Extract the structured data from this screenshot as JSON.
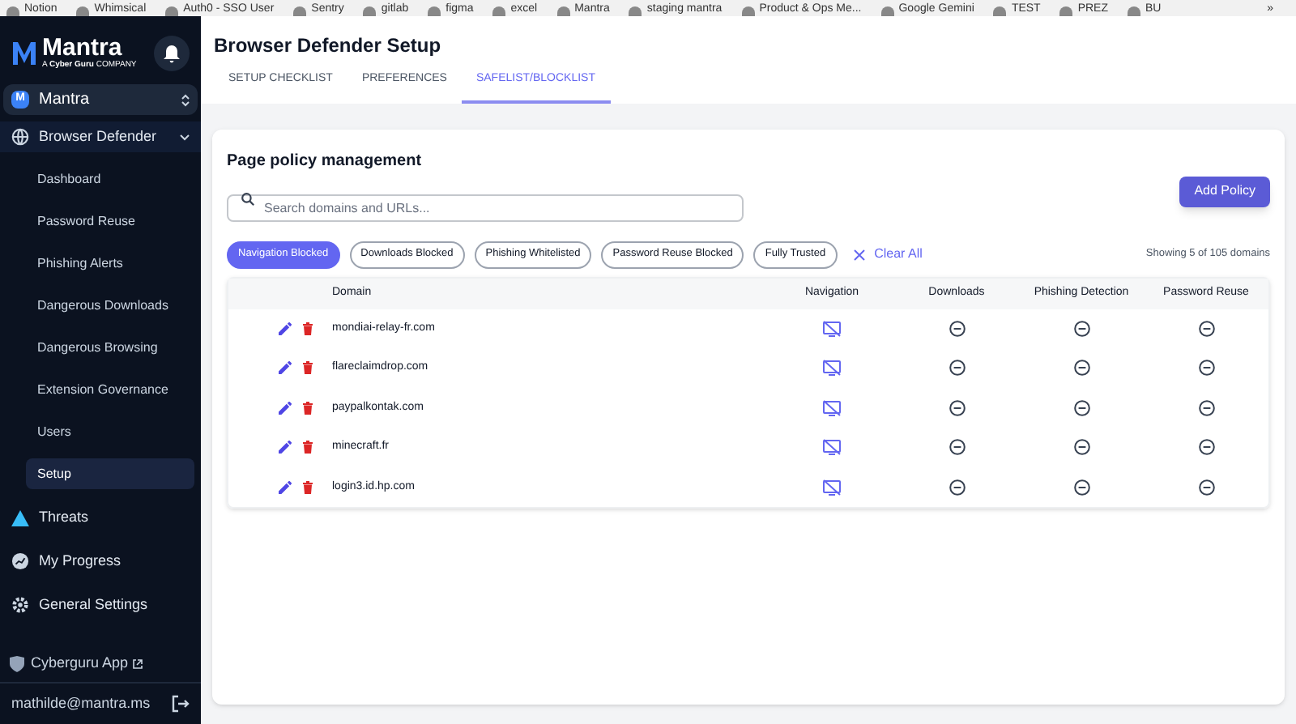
{
  "bookmarks": [
    "Notion",
    "Whimsical",
    "Auth0 - SSO User",
    "Sentry",
    "gitlab",
    "figma",
    "excel",
    "Mantra",
    "staging mantra",
    "Product & Ops Me...",
    "Google Gemini",
    "TEST",
    "PREZ",
    "BU"
  ],
  "bookmarks_more": "»",
  "sidebar": {
    "brand": "Mantra",
    "brand_sub": "A **Cyber Guru** COMPANY",
    "org": {
      "badge": "M",
      "name": "Mantra"
    },
    "items": [
      {
        "label": "Browser Defender",
        "kind": "globe",
        "expanded": true,
        "selected": false,
        "children": [
          {
            "label": "Dashboard",
            "selected": false
          },
          {
            "label": "Password Reuse",
            "selected": false
          },
          {
            "label": "Phishing Alerts",
            "selected": false
          },
          {
            "label": "Dangerous Downloads",
            "selected": false
          },
          {
            "label": "Dangerous Browsing",
            "selected": false
          },
          {
            "label": "Extension Governance",
            "selected": false
          },
          {
            "label": "Users",
            "selected": false
          },
          {
            "label": "Setup",
            "selected": true
          }
        ]
      },
      {
        "label": "Threats",
        "kind": "warning",
        "selected": false
      },
      {
        "label": "My Progress",
        "kind": "progress",
        "selected": false
      },
      {
        "label": "General Settings",
        "kind": "gear",
        "selected": false
      }
    ],
    "app_link": "Cyberguru App",
    "user_email": "mathilde@mantra.ms"
  },
  "header": {
    "title": "Browser Defender Setup",
    "tabs": [
      {
        "label": "SETUP CHECKLIST",
        "selected": false
      },
      {
        "label": "PREFERENCES",
        "selected": false
      },
      {
        "label": "SAFELIST/BLOCKLIST",
        "selected": true
      }
    ]
  },
  "card": {
    "title": "Page policy management",
    "search": {
      "placeholder": "Search domains and URLs..."
    },
    "add_button": "Add Policy",
    "filters": [
      {
        "label": "Navigation Blocked",
        "selected": true
      },
      {
        "label": "Downloads Blocked",
        "selected": false
      },
      {
        "label": "Phishing Whitelisted",
        "selected": false
      },
      {
        "label": "Password Reuse Blocked",
        "selected": false
      },
      {
        "label": "Fully Trusted",
        "selected": false
      }
    ],
    "clear_all": "Clear All",
    "count": "Showing 5 of 105 domains",
    "columns": [
      "Domain",
      "Navigation",
      "Downloads",
      "Phishing Detection",
      "Password Reuse"
    ],
    "rows": [
      {
        "domain": "mondiai-relay-fr.com",
        "navigation_blocked": true,
        "downloads_blocked": false,
        "phishing_blocked": false,
        "password_blocked": false
      },
      {
        "domain": "flareclaimdrop.com",
        "navigation_blocked": true,
        "downloads_blocked": false,
        "phishing_blocked": false,
        "password_blocked": false
      },
      {
        "domain": "paypalkontak.com",
        "navigation_blocked": true,
        "downloads_blocked": false,
        "phishing_blocked": false,
        "password_blocked": false
      },
      {
        "domain": "minecraft.fr",
        "navigation_blocked": true,
        "downloads_blocked": false,
        "phishing_blocked": false,
        "password_blocked": false
      },
      {
        "domain": "login3.id.hp.com",
        "navigation_blocked": true,
        "downloads_blocked": false,
        "phishing_blocked": false,
        "password_blocked": false
      }
    ]
  }
}
